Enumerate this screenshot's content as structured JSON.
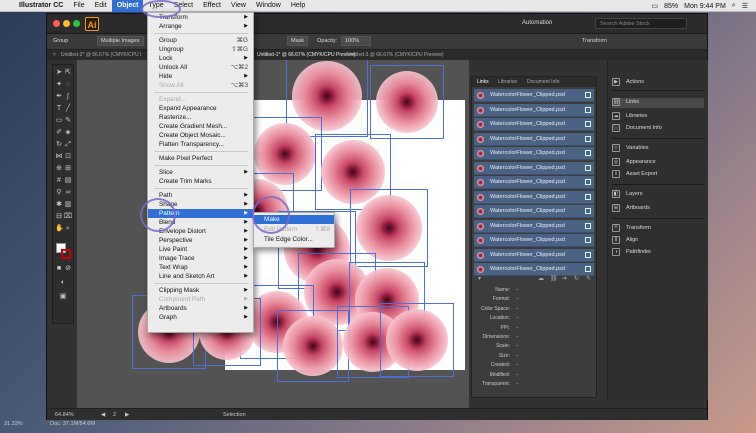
{
  "menubar": {
    "apple": "",
    "app_name": "Illustrator CC",
    "items": [
      "File",
      "Edit",
      "Object",
      "Type",
      "Select",
      "Effect",
      "View",
      "Window",
      "Help"
    ],
    "active": "Object",
    "battery": "85%",
    "clock": "Mon 9:44 PM"
  },
  "app": {
    "logo": "Ai",
    "workspace": "Automation",
    "stock_search_placeholder": "Search Adobe Stock"
  },
  "controlbar": {
    "selection_label": "Group",
    "multiple_images_label": "Multiple Images",
    "mask_label": "Mask",
    "opacity_label": "Opacity:",
    "opacity_value": "100%",
    "transform_label": "Transform"
  },
  "tabs": [
    "Untitled-2* @ 66.67% (CMYK/CPU Preview)",
    "Untitled-1* @ 66.67% (CMYK/CPU Preview)",
    "Untitled-3 @ 66.67% (CMYK/CPU Preview)"
  ],
  "tab_close_glyph": "×",
  "object_menu": {
    "items": [
      {
        "label": "Transform",
        "arrow": true
      },
      {
        "label": "Arrange",
        "arrow": true
      },
      {
        "sep": true
      },
      {
        "label": "Group",
        "shortcut": "⌘G"
      },
      {
        "label": "Ungroup",
        "shortcut": "⇧⌘G"
      },
      {
        "label": "Lock",
        "arrow": true
      },
      {
        "label": "Unlock All",
        "shortcut": "⌥⌘2"
      },
      {
        "label": "Hide",
        "arrow": true
      },
      {
        "label": "Show All",
        "shortcut": "⌥⌘3",
        "disabled": true
      },
      {
        "sep": true
      },
      {
        "label": "Expand...",
        "disabled": true
      },
      {
        "label": "Expand Appearance"
      },
      {
        "label": "Rasterize..."
      },
      {
        "label": "Create Gradient Mesh..."
      },
      {
        "label": "Create Object Mosaic..."
      },
      {
        "label": "Flatten Transparency..."
      },
      {
        "sep": true
      },
      {
        "label": "Make Pixel Perfect"
      },
      {
        "sep": true
      },
      {
        "label": "Slice",
        "arrow": true
      },
      {
        "label": "Create Trim Marks"
      },
      {
        "sep": true
      },
      {
        "label": "Path",
        "arrow": true
      },
      {
        "label": "Shape",
        "arrow": true
      },
      {
        "label": "Pattern",
        "arrow": true,
        "highlighted": true
      },
      {
        "label": "Blend",
        "arrow": true
      },
      {
        "label": "Envelope Distort",
        "arrow": true
      },
      {
        "label": "Perspective",
        "arrow": true
      },
      {
        "label": "Live Paint",
        "arrow": true
      },
      {
        "label": "Image Trace",
        "arrow": true
      },
      {
        "label": "Text Wrap",
        "arrow": true
      },
      {
        "label": "Line and Sketch Art",
        "arrow": true
      },
      {
        "sep": true
      },
      {
        "label": "Clipping Mask",
        "arrow": true
      },
      {
        "label": "Compound Path",
        "arrow": true,
        "disabled": true
      },
      {
        "label": "Artboards",
        "arrow": true
      },
      {
        "label": "Graph",
        "arrow": true
      }
    ],
    "arrow_glyph": "▶"
  },
  "pattern_submenu": {
    "items": [
      {
        "label": "Make",
        "highlighted": true
      },
      {
        "label": "Edit Pattern",
        "shortcut": "⇧⌘8",
        "disabled": true
      },
      {
        "label": "Tile Edge Color..."
      }
    ]
  },
  "links_panel": {
    "tabs": [
      "Links",
      "Libraries",
      "Document Info"
    ],
    "rows": [
      "WatercolorFlower_Clipped.psd",
      "WatercolorFlower_Clipped.psd",
      "WatercolorFlower_Clipped.psd",
      "WatercolorFlower_Clipped.psd",
      "WatercolorFlower_Clipped.psd",
      "WatercolorFlower_Clipped.psd",
      "WatercolorFlower_Clipped.psd",
      "WatercolorFlower_Clipped.psd",
      "WatercolorFlower_Clipped.psd",
      "WatercolorFlower_Clipped.psd",
      "WatercolorFlower_Clipped.psd",
      "WatercolorFlower_Clipped.psd",
      "WatercolorFlower_Clipped.psd"
    ],
    "info": [
      "Name:",
      "Format:",
      "Color Space:",
      "Location:",
      "PPI:",
      "Dimensions:",
      "Scale:",
      "Size:",
      "Created:",
      "Modified:",
      "Transparent:"
    ],
    "info_value": "–"
  },
  "dock": {
    "items": [
      "Actions",
      "Links",
      "Libraries",
      "Document Info",
      "Variables",
      "Appearance",
      "Asset Export",
      "Layers",
      "Artboards",
      "Transform",
      "Align",
      "Pathfinder"
    ]
  },
  "status": {
    "zoom": "64.84%",
    "artboard": "2",
    "tool": "Selection",
    "footer_zoom": "31.33%",
    "doc_size": "Doc: 37.1M/54.6M"
  },
  "colors": {
    "highlight": "#2f6fd6",
    "callout_circle": "#7a68c8",
    "link_row": "#4a6385"
  }
}
